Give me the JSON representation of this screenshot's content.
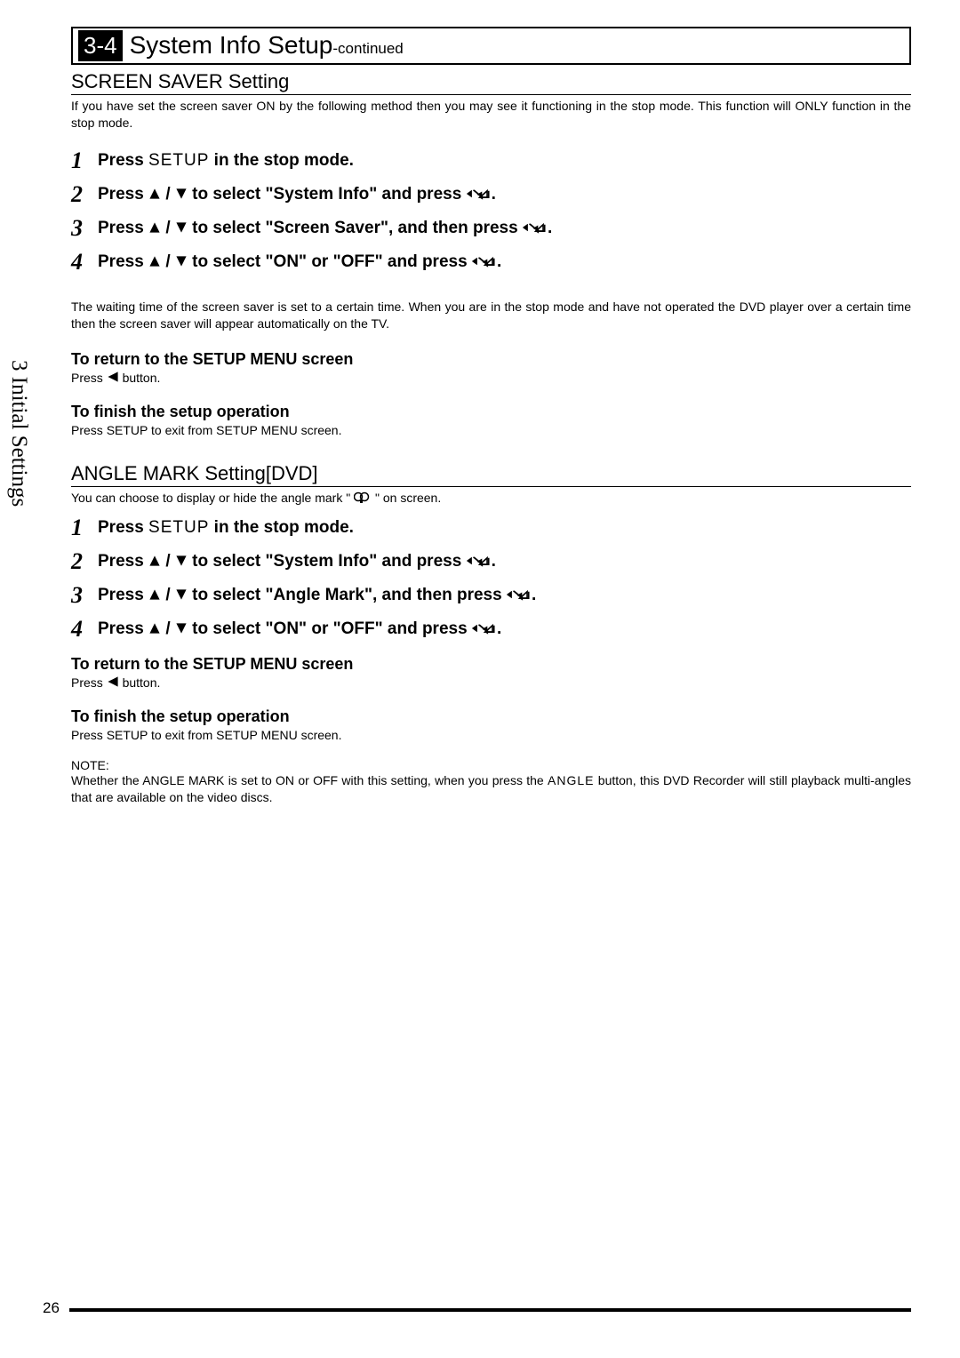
{
  "header": {
    "badge": "3-4",
    "title": "System Info Setup",
    "continued": "-continued"
  },
  "side_tab": "3 Initial Settings",
  "page_number": "26",
  "screen_saver": {
    "heading": "SCREEN SAVER Setting",
    "intro": "If you have set the screen saver ON by the following method then you may see it functioning in the stop mode. This function will ONLY function in the stop mode.",
    "steps": [
      {
        "n": "1",
        "pre": "Press ",
        "setup": "SETUP",
        "post": " in the stop mode."
      },
      {
        "n": "2",
        "pre": "Press ",
        "mid": " to select \"System Info\" and press ",
        "post": "."
      },
      {
        "n": "3",
        "pre": "Press ",
        "mid": " to select \"Screen Saver\", and then press ",
        "post": "."
      },
      {
        "n": "4",
        "pre": "Press ",
        "mid": " to select \"ON\" or \"OFF\" and press ",
        "post": "."
      }
    ],
    "note": "The waiting time of the screen saver is set to a certain time. When you are in the stop mode and have not operated the DVD player over a certain time then the screen saver will appear automatically on the TV.",
    "return_heading": "To return to the SETUP MENU screen",
    "return_text_pre": "Press ",
    "return_text_post": " button.",
    "finish_heading": "To finish the setup operation",
    "finish_text_pre": "Press ",
    "finish_text_setup": "SETUP",
    "finish_text_post": " to exit from SETUP MENU screen."
  },
  "angle_mark": {
    "heading": "ANGLE MARK Setting[DVD]",
    "intro_pre": "You can choose to display or hide the angle mark \" ",
    "intro_post": " \" on screen.",
    "steps": [
      {
        "n": "1",
        "pre": "Press ",
        "setup": "SETUP",
        "post": " in the stop mode."
      },
      {
        "n": "2",
        "pre": "Press ",
        "mid": "to select \"System Info\" and press ",
        "post": "."
      },
      {
        "n": "3",
        "pre": "Press ",
        "mid": "to select \"Angle Mark\", and then press ",
        "post": "."
      },
      {
        "n": "4",
        "pre": "Press ",
        "mid": "to select \"ON\" or \"OFF\" and press ",
        "post": "."
      }
    ],
    "return_heading": "To return to the SETUP MENU screen",
    "return_text_pre": "Press ",
    "return_text_post": " button.",
    "finish_heading": "To finish the setup operation",
    "finish_text_pre": "Press ",
    "finish_text_setup": "SETUP",
    "finish_text_post": " to exit from SETUP MENU screen.",
    "note_label": "NOTE:",
    "note_body_pre": "Whether the ANGLE MARK is set to ON or OFF with this setting, when you press the ",
    "note_body_angle": "ANGLE",
    "note_body_post": " button, this DVD Recorder will still playback multi-angles that are available on the video discs."
  }
}
